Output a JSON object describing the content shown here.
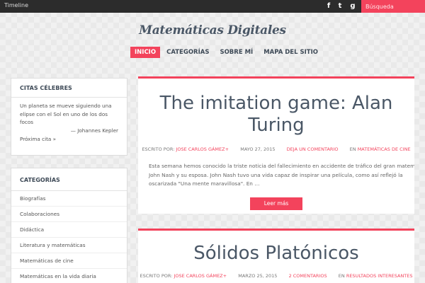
{
  "topbar": {
    "timeline_label": "Timeline",
    "social": [
      {
        "icon": "facebook-icon",
        "glyph": "f"
      },
      {
        "icon": "twitter-icon",
        "glyph": "t"
      },
      {
        "icon": "google-plus-icon",
        "glyph": "g"
      }
    ],
    "search_placeholder": "Búsqueda"
  },
  "header": {
    "site_title": "Matemáticas Digitales",
    "nav": [
      {
        "label": "INICIO",
        "active": true
      },
      {
        "label": "CATEGORÍAS",
        "active": false
      },
      {
        "label": "SOBRE MÍ",
        "active": false
      },
      {
        "label": "MAPA DEL SITIO",
        "active": false
      }
    ]
  },
  "sidebar": {
    "quotes_widget": {
      "title": "CITAS CÉLEBRES",
      "quote": "Un planeta se mueve siguiendo una elipse con el Sol en uno de los dos focos",
      "author": "— Johannes Kepler",
      "next_label": "Próxima cita »"
    },
    "categories_widget": {
      "title": "CATEGORÍAS",
      "items": [
        "Biografías",
        "Colaboraciones",
        "Didáctica",
        "Literatura y matemáticas",
        "Matemáticas de cine",
        "Matemáticas en la vida diaria"
      ]
    }
  },
  "posts": [
    {
      "title": "The imitation game: Alan Turing",
      "written_by_label": "ESCRITO POR:",
      "author": "JOSE CARLOS GÁMEZ+",
      "date": "MAYO 27, 2015",
      "comments": "DEJA UN COMENTARIO",
      "in_label": "EN",
      "category": "MATEMÁTICAS DE CINE",
      "excerpt_lines": [
        "Esta semana hemos conocido la triste noticia del fallecimiento en accidente de tráfico del gran matem",
        "John Nash y su esposa. John Nash tuvo una vida capaz de inspirar una película, como así reflejó la",
        "oscarizada \"Una mente maravillosa\". En …"
      ],
      "read_more": "Leer más"
    },
    {
      "title": "Sólidos Platónicos",
      "written_by_label": "ESCRITO POR:",
      "author": "JOSE CARLOS GÁMEZ+",
      "date": "MARZO 25, 2015",
      "comments": "2 COMENTARIOS",
      "in_label": "EN",
      "category": "RESULTADOS INTERESANTES"
    }
  ],
  "colors": {
    "accent": "#f3435c",
    "topbar": "#2c2c2c",
    "title": "#4a5766"
  }
}
